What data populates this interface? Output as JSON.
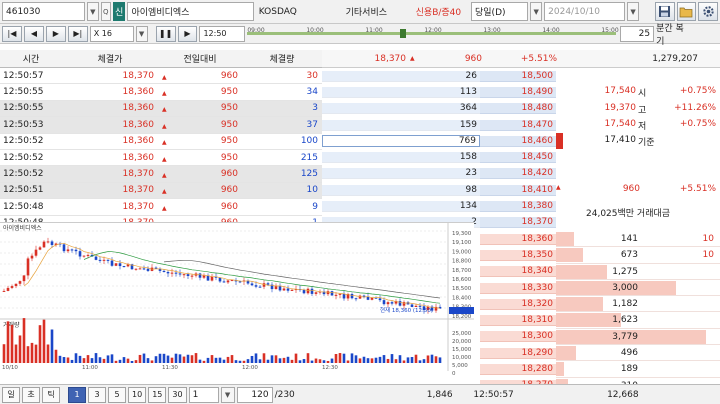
{
  "top": {
    "code": "461030",
    "badge": "신",
    "name": "아이엠비디엑스",
    "market": "KOSDAQ",
    "sector": "기타서비스",
    "credit": "신용B/증40",
    "period": "당일(D)",
    "date": "2024/10/10"
  },
  "nav": {
    "multiplier": "X 16",
    "time": "12:50",
    "slider_ticks": [
      "09:00",
      "10:00",
      "11:00",
      "12:00",
      "13:00",
      "14:00",
      "15:00"
    ],
    "progress": 0.42,
    "minutes": "25",
    "minutes_label": "분간 복기"
  },
  "trades": {
    "headers": [
      "시간",
      "체결가",
      "전일대비",
      "체결량"
    ],
    "rows": [
      {
        "t": "12:50:57",
        "p": "18,370",
        "d": "960",
        "v": "30",
        "pc": "red",
        "vc": "red",
        "hl": false
      },
      {
        "t": "12:50:55",
        "p": "18,360",
        "d": "950",
        "v": "34",
        "pc": "red",
        "vc": "blue",
        "hl": false
      },
      {
        "t": "12:50:55",
        "p": "18,360",
        "d": "950",
        "v": "3",
        "pc": "red",
        "vc": "blue",
        "hl": true
      },
      {
        "t": "12:50:53",
        "p": "18,360",
        "d": "950",
        "v": "37",
        "pc": "red",
        "vc": "blue",
        "hl": true
      },
      {
        "t": "12:50:52",
        "p": "18,360",
        "d": "950",
        "v": "100",
        "pc": "red",
        "vc": "blue",
        "hl": false
      },
      {
        "t": "12:50:52",
        "p": "18,360",
        "d": "950",
        "v": "215",
        "pc": "red",
        "vc": "blue",
        "hl": false
      },
      {
        "t": "12:50:52",
        "p": "18,370",
        "d": "960",
        "v": "125",
        "pc": "red",
        "vc": "blue",
        "hl": true
      },
      {
        "t": "12:50:51",
        "p": "18,370",
        "d": "960",
        "v": "10",
        "pc": "red",
        "vc": "blue",
        "hl": true
      },
      {
        "t": "12:50:48",
        "p": "18,370",
        "d": "960",
        "v": "9",
        "pc": "red",
        "vc": "blue",
        "hl": false
      },
      {
        "t": "12:50:48",
        "p": "18,370",
        "d": "960",
        "v": "1",
        "pc": "red",
        "vc": "blue",
        "hl": false
      }
    ]
  },
  "orderbook": {
    "cur_price": "18,370",
    "cur_diff": "960",
    "cur_rate": "+5.51%",
    "total_vol": "1,279,207",
    "asks": [
      {
        "q": "26",
        "p": "18,500"
      },
      {
        "q": "113",
        "p": "18,490"
      },
      {
        "q": "364",
        "p": "18,480"
      },
      {
        "q": "159",
        "p": "18,470"
      },
      {
        "q": "769",
        "p": "18,460"
      },
      {
        "q": "158",
        "p": "18,450"
      },
      {
        "q": "23",
        "p": "18,420"
      },
      {
        "q": "98",
        "p": "18,410"
      },
      {
        "q": "134",
        "p": "18,380"
      },
      {
        "q": "2",
        "p": "18,370"
      }
    ],
    "bids": [
      {
        "p": "18,360",
        "q": "141",
        "bar": 0.12
      },
      {
        "p": "18,350",
        "q": "673",
        "bar": 0.18
      },
      {
        "p": "18,340",
        "q": "1,275",
        "bar": 0.34
      },
      {
        "p": "18,330",
        "q": "3,000",
        "bar": 0.8
      },
      {
        "p": "18,320",
        "q": "1,182",
        "bar": 0.31
      },
      {
        "p": "18,310",
        "q": "1,623",
        "bar": 0.43
      },
      {
        "p": "18,300",
        "q": "3,779",
        "bar": 1.0
      },
      {
        "p": "18,290",
        "q": "496",
        "bar": 0.13
      },
      {
        "p": "18,280",
        "q": "189",
        "bar": 0.05
      },
      {
        "p": "18,270",
        "q": "310",
        "bar": 0.08
      }
    ],
    "info": [
      {
        "v": "17,540",
        "l": "시",
        "r": "+0.75%"
      },
      {
        "v": "19,370",
        "l": "고",
        "r": "+11.26%"
      },
      {
        "v": "17,540",
        "l": "저",
        "r": "+0.75%"
      },
      {
        "v": "17,410",
        "l": "기준",
        "r": ""
      }
    ],
    "info_diff": "960",
    "info_rate": "+5.51%",
    "amount": "24,025백만 거래대금",
    "right_edge": "10",
    "right_edge2": "10"
  },
  "chart_labels": {
    "legend1": "아이엠비디엑스",
    "legend2": "BOLLINGER",
    "vol_legend": "거래량",
    "last_label": "현재 18,360 (12:50)",
    "ticks_right": [
      "19,300",
      "19,100",
      "19,000",
      "18,800",
      "18,700",
      "18,600",
      "18,500",
      "18,400",
      "18,300",
      "18,200"
    ],
    "vol_ticks": [
      "25,000",
      "20,000",
      "15,000",
      "10,000",
      "5,000",
      "0"
    ],
    "x_ticks": [
      "10/10",
      "11:00",
      "11:30",
      "12:00",
      "12:30"
    ]
  },
  "bottom": {
    "b1": "일",
    "b2": "초",
    "b3": "틱",
    "mins": [
      "1",
      "3",
      "5",
      "10",
      "15",
      "30"
    ],
    "count": "1",
    "page": "120",
    "page_total": "/230",
    "vol_total": "1,846",
    "time": "12:50:57",
    "amt": "12,668"
  },
  "colors": {
    "up": "#d93025",
    "down": "#1a47c9",
    "ask_bg": "#dde7f5",
    "bid_bg": "#fadbd4"
  }
}
